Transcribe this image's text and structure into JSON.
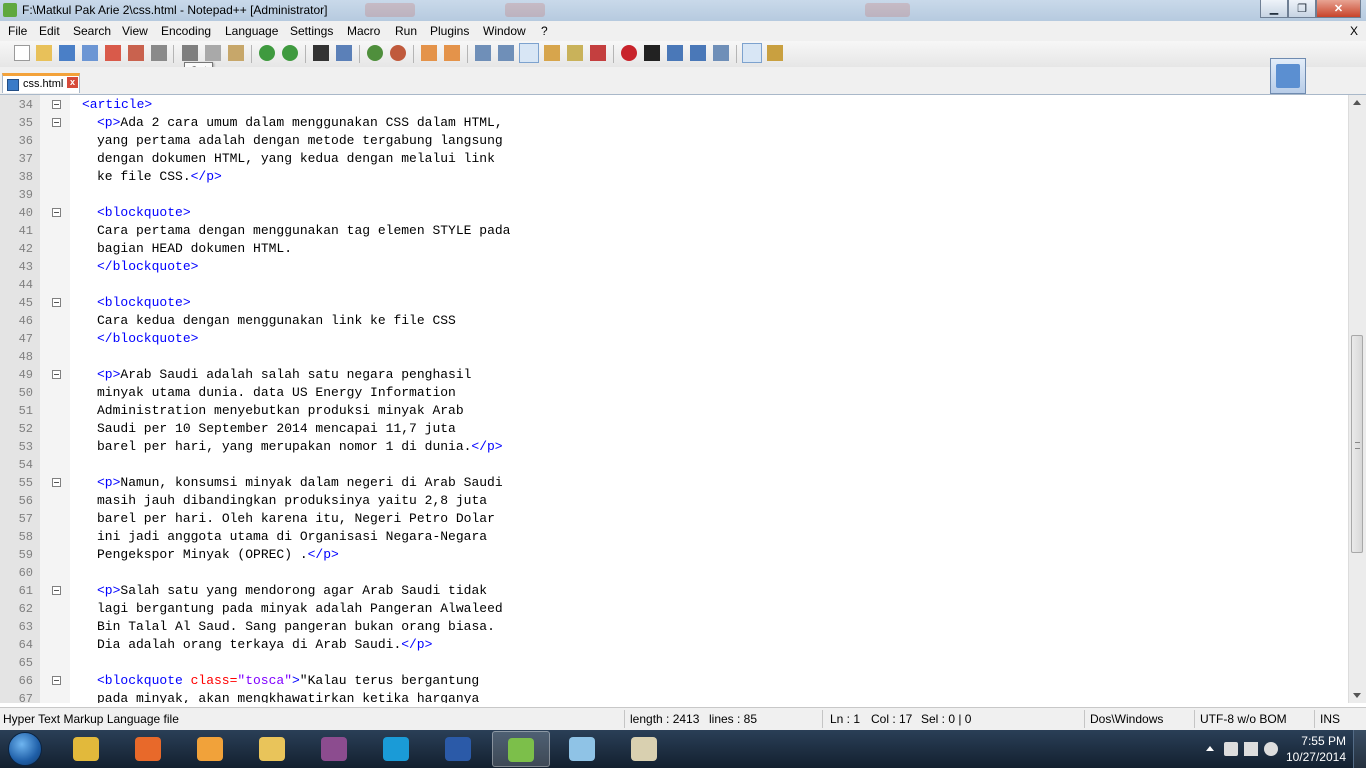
{
  "window": {
    "title": "F:\\Matkul Pak Arie 2\\css.html - Notepad++ [Administrator]",
    "minimize": "▁",
    "maximize": "❐",
    "close": "✕"
  },
  "menubar": {
    "items": [
      "File",
      "Edit",
      "Search",
      "View",
      "Encoding",
      "Language",
      "Settings",
      "Macro",
      "Run",
      "Plugins",
      "Window",
      "?"
    ],
    "close_label": "X"
  },
  "toolbar": {
    "tooltip": "Cut"
  },
  "tabs": [
    {
      "label": "css.html"
    }
  ],
  "editor": {
    "lines": [
      {
        "n": "34",
        "fold": true,
        "indent": 1,
        "segments": [
          {
            "t": "<article>",
            "c": "tag"
          }
        ]
      },
      {
        "n": "35",
        "fold": true,
        "indent": 2,
        "segments": [
          {
            "t": "<p>",
            "c": "tag"
          },
          {
            "t": "Ada 2 cara umum dalam menggunakan CSS dalam HTML,",
            "c": "text"
          }
        ]
      },
      {
        "n": "36",
        "indent": 2,
        "segments": [
          {
            "t": "yang pertama adalah dengan metode tergabung langsung",
            "c": "text"
          }
        ]
      },
      {
        "n": "37",
        "indent": 2,
        "segments": [
          {
            "t": "dengan dokumen HTML, yang kedua dengan melalui link",
            "c": "text"
          }
        ]
      },
      {
        "n": "38",
        "indent": 2,
        "segments": [
          {
            "t": "ke file CSS.",
            "c": "text"
          },
          {
            "t": "</p>",
            "c": "tag"
          }
        ]
      },
      {
        "n": "39",
        "indent": 0,
        "segments": []
      },
      {
        "n": "40",
        "fold": true,
        "indent": 2,
        "segments": [
          {
            "t": "<blockquote>",
            "c": "tag"
          }
        ]
      },
      {
        "n": "41",
        "indent": 2,
        "segments": [
          {
            "t": "Cara pertama dengan menggunakan tag elemen STYLE pada",
            "c": "text"
          }
        ]
      },
      {
        "n": "42",
        "indent": 2,
        "segments": [
          {
            "t": "bagian HEAD dokumen HTML.",
            "c": "text"
          }
        ]
      },
      {
        "n": "43",
        "indent": 2,
        "segments": [
          {
            "t": "</blockquote>",
            "c": "tag"
          }
        ]
      },
      {
        "n": "44",
        "indent": 0,
        "segments": []
      },
      {
        "n": "45",
        "fold": true,
        "indent": 2,
        "segments": [
          {
            "t": "<blockquote>",
            "c": "tag"
          }
        ]
      },
      {
        "n": "46",
        "indent": 2,
        "segments": [
          {
            "t": "Cara kedua dengan menggunakan link ke file CSS",
            "c": "text"
          }
        ]
      },
      {
        "n": "47",
        "indent": 2,
        "segments": [
          {
            "t": "</blockquote>",
            "c": "tag"
          }
        ]
      },
      {
        "n": "48",
        "indent": 0,
        "segments": []
      },
      {
        "n": "49",
        "fold": true,
        "indent": 2,
        "segments": [
          {
            "t": "<p>",
            "c": "tag"
          },
          {
            "t": "Arab Saudi adalah salah satu negara penghasil",
            "c": "text"
          }
        ]
      },
      {
        "n": "50",
        "indent": 2,
        "segments": [
          {
            "t": "minyak utama dunia. data US Energy Information",
            "c": "text"
          }
        ]
      },
      {
        "n": "51",
        "indent": 2,
        "segments": [
          {
            "t": "Administration menyebutkan produksi minyak Arab",
            "c": "text"
          }
        ]
      },
      {
        "n": "52",
        "indent": 2,
        "segments": [
          {
            "t": "Saudi per 10 September 2014 mencapai 11,7 juta",
            "c": "text"
          }
        ]
      },
      {
        "n": "53",
        "indent": 2,
        "segments": [
          {
            "t": "barel per hari, yang merupakan nomor 1 di dunia.",
            "c": "text"
          },
          {
            "t": "</p>",
            "c": "tag"
          }
        ]
      },
      {
        "n": "54",
        "indent": 0,
        "segments": []
      },
      {
        "n": "55",
        "fold": true,
        "indent": 2,
        "segments": [
          {
            "t": "<p>",
            "c": "tag"
          },
          {
            "t": "Namun, konsumsi minyak dalam negeri di Arab Saudi",
            "c": "text"
          }
        ]
      },
      {
        "n": "56",
        "indent": 2,
        "segments": [
          {
            "t": "masih jauh dibandingkan produksinya yaitu 2,8 juta",
            "c": "text"
          }
        ]
      },
      {
        "n": "57",
        "indent": 2,
        "segments": [
          {
            "t": "barel per hari. Oleh karena itu, Negeri Petro Dolar",
            "c": "text"
          }
        ]
      },
      {
        "n": "58",
        "indent": 2,
        "segments": [
          {
            "t": "ini jadi anggota utama di Organisasi Negara-Negara",
            "c": "text"
          }
        ]
      },
      {
        "n": "59",
        "indent": 2,
        "segments": [
          {
            "t": "Pengekspor Minyak (OPREC) .",
            "c": "text"
          },
          {
            "t": "</p>",
            "c": "tag"
          }
        ]
      },
      {
        "n": "60",
        "indent": 0,
        "segments": []
      },
      {
        "n": "61",
        "fold": true,
        "indent": 2,
        "segments": [
          {
            "t": "<p>",
            "c": "tag"
          },
          {
            "t": "Salah satu yang mendorong agar Arab Saudi tidak",
            "c": "text"
          }
        ]
      },
      {
        "n": "62",
        "indent": 2,
        "segments": [
          {
            "t": "lagi bergantung pada minyak adalah Pangeran Alwaleed",
            "c": "text"
          }
        ]
      },
      {
        "n": "63",
        "indent": 2,
        "segments": [
          {
            "t": "Bin Talal Al Saud. Sang pangeran bukan orang biasa.",
            "c": "text"
          }
        ]
      },
      {
        "n": "64",
        "indent": 2,
        "segments": [
          {
            "t": "Dia adalah orang terkaya di Arab Saudi.",
            "c": "text"
          },
          {
            "t": "</p>",
            "c": "tag"
          }
        ]
      },
      {
        "n": "65",
        "indent": 0,
        "segments": []
      },
      {
        "n": "66",
        "fold": true,
        "indent": 2,
        "segments": [
          {
            "t": "<blockquote ",
            "c": "tag"
          },
          {
            "t": "class=",
            "c": "attr"
          },
          {
            "t": "\"tosca\"",
            "c": "str"
          },
          {
            "t": ">",
            "c": "tag"
          },
          {
            "t": "\"Kalau terus bergantung",
            "c": "text"
          }
        ]
      },
      {
        "n": "67",
        "indent": 2,
        "segments": [
          {
            "t": "pada minyak, akan mengkhawatirkan ketika harganya",
            "c": "text"
          }
        ]
      }
    ]
  },
  "status": {
    "file_type": "Hyper Text Markup Language file",
    "length": "length : 2413",
    "lines": "lines : 85",
    "ln": "Ln : 1",
    "col": "Col : 17",
    "sel": "Sel : 0 | 0",
    "eol": "Dos\\Windows",
    "encoding": "UTF-8 w/o BOM",
    "mode": "INS"
  },
  "taskbar": {
    "apps": [
      {
        "name": "chrome",
        "color": "#e2b93b",
        "active": false
      },
      {
        "name": "firefox",
        "color": "#e8692a",
        "active": false
      },
      {
        "name": "media-player",
        "color": "#f1a23a",
        "active": false
      },
      {
        "name": "file-explorer",
        "color": "#e9c45a",
        "active": false
      },
      {
        "name": "winrar",
        "color": "#8c4c8f",
        "active": false
      },
      {
        "name": "skype",
        "color": "#1a9bd7",
        "active": false
      },
      {
        "name": "word",
        "color": "#2b5aa8",
        "active": false
      },
      {
        "name": "notepad-plus-plus",
        "color": "#7cbf4a",
        "active": true
      },
      {
        "name": "notepad",
        "color": "#8fc3e6",
        "active": false
      },
      {
        "name": "paint",
        "color": "#d9d0b0",
        "active": false
      }
    ],
    "clock_time": "7:55 PM",
    "clock_date": "10/27/2014"
  },
  "colors": {
    "tag": "#0000ff",
    "attr": "#ff0000",
    "str": "#8000ff",
    "text": "#000000",
    "tab_accent": "#f3a23a"
  }
}
